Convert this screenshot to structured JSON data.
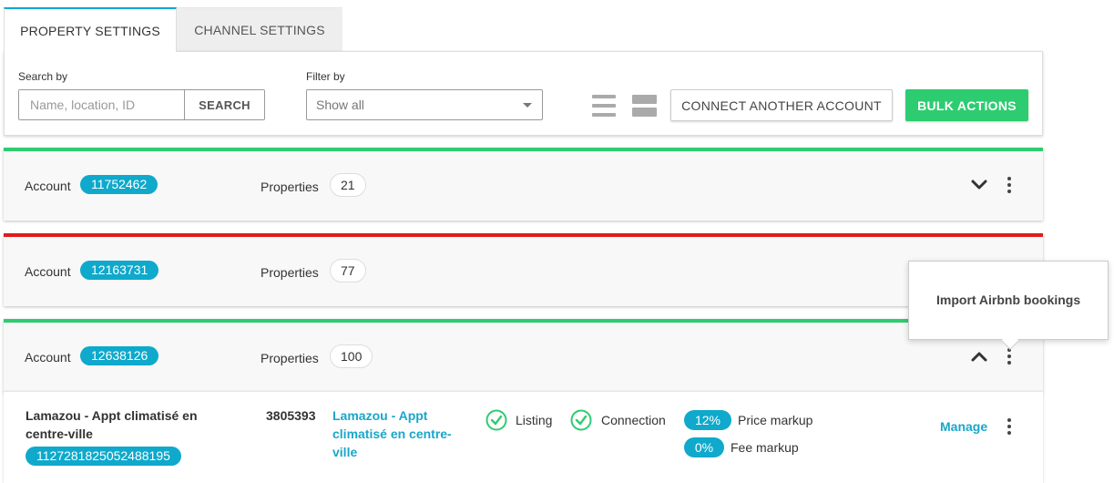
{
  "tabs": [
    {
      "label": "PROPERTY SETTINGS",
      "active": true
    },
    {
      "label": "CHANNEL SETTINGS",
      "active": false
    }
  ],
  "toolbar": {
    "search_label": "Search by",
    "search_placeholder": "Name, location, ID",
    "search_button": "SEARCH",
    "filter_label": "Filter by",
    "filter_value": "Show all",
    "connect_button": "CONNECT ANOTHER ACCOUNT",
    "bulk_button": "BULK ACTIONS"
  },
  "accounts": [
    {
      "label": "Account",
      "id": "11752462",
      "properties_label": "Properties",
      "count": "21",
      "status_color": "#2ecc71",
      "expanded": false
    },
    {
      "label": "Account",
      "id": "12163731",
      "properties_label": "Properties",
      "count": "77",
      "status_color": "#e01c1c",
      "expanded": false
    },
    {
      "label": "Account",
      "id": "12638126",
      "properties_label": "Properties",
      "count": "100",
      "status_color": "#2ecc71",
      "expanded": true
    }
  ],
  "popover": {
    "item": "Import Airbnb bookings"
  },
  "property": {
    "name": "Lamazou - Appt climatisé en centre-ville",
    "listing_id": "1127281825052488195",
    "property_id": "3805393",
    "link_text": "Lamazou - Appt climatisé en centre-ville",
    "listing_label": "Listing",
    "connection_label": "Connection",
    "price_markup_value": "12%",
    "price_markup_label": "Price markup",
    "fee_markup_value": "0%",
    "fee_markup_label": "Fee markup",
    "manage_label": "Manage"
  },
  "colors": {
    "accent": "#0fa9cc",
    "success": "#2ecc71",
    "danger": "#e01c1c",
    "fee_pill": "#0fa9cc"
  }
}
